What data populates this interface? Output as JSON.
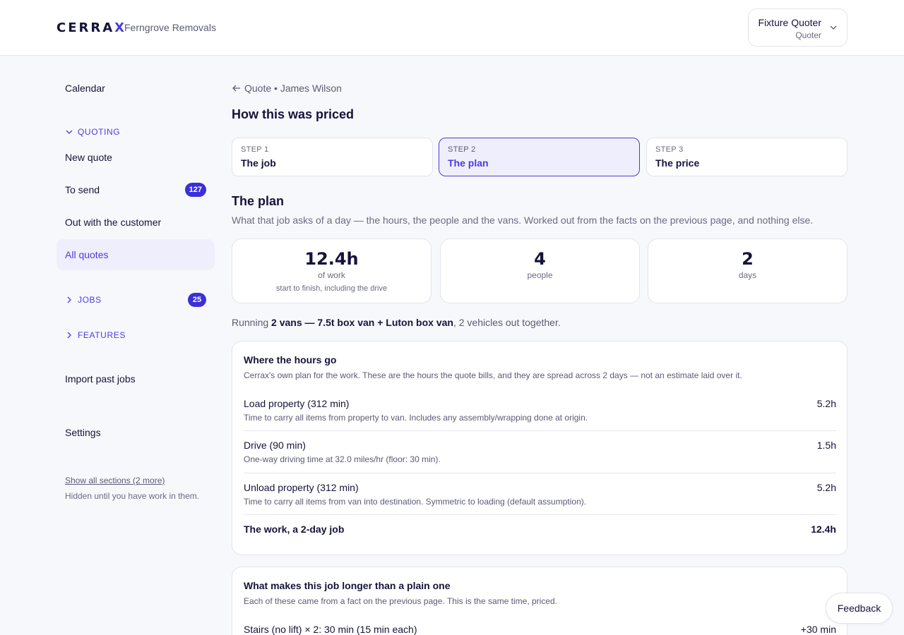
{
  "header": {
    "logo_main": "CERRA",
    "logo_accent": "X",
    "company": "Ferngrove Removals",
    "user_name": "Fixture Quoter",
    "user_role": "Quoter"
  },
  "sidebar": {
    "calendar": "Calendar",
    "quoting_section": "QUOTING",
    "new_quote": "New quote",
    "to_send": "To send",
    "to_send_count": "127",
    "out_with_customer": "Out with the customer",
    "all_quotes": "All quotes",
    "jobs_section": "JOBS",
    "jobs_count": "25",
    "features_section": "FEATURES",
    "import_past_jobs": "Import past jobs",
    "settings": "Settings",
    "show_all": "Show all sections (2 more)",
    "hidden_note": "Hidden until you have work in them."
  },
  "main": {
    "breadcrumb": "Quote • James Wilson",
    "title": "How this was priced",
    "steps": [
      {
        "num": "STEP 1",
        "name": "The job"
      },
      {
        "num": "STEP 2",
        "name": "The plan"
      },
      {
        "num": "STEP 3",
        "name": "The price"
      }
    ],
    "section_title": "The plan",
    "section_sub": "What that job asks of a day — the hours, the people and the vans. Worked out from the facts on the previous page, and nothing else.",
    "stats": [
      {
        "value": "12.4h",
        "label": "of work",
        "note": "start to finish, including the drive"
      },
      {
        "value": "4",
        "label": "people"
      },
      {
        "value": "2",
        "label": "days"
      }
    ],
    "running_prefix": "Running",
    "running_bold": "2 vans — 7.5t box van + Luton box van",
    "running_suffix": ", 2 vehicles out together."
  },
  "hours_card": {
    "title": "Where the hours go",
    "subtitle": "Cerrax's own plan for the work. These are the hours the quote bills, and they are spread across 2 days — not an estimate laid over it.",
    "rows": [
      {
        "name": "Load property (312 min)",
        "desc": "Time to carry all items from property to van. Includes any assembly/wrapping done at origin.",
        "value": "5.2h"
      },
      {
        "name": "Drive (90 min)",
        "desc": "One-way driving time at 32.0 miles/hr (floor: 30 min).",
        "value": "1.5h"
      },
      {
        "name": "Unload property (312 min)",
        "desc": "Time to carry all items from van into destination. Symmetric to loading (default assumption).",
        "value": "5.2h"
      }
    ],
    "total_label": "The work, a 2-day job",
    "total_value": "12.4h"
  },
  "longer_card": {
    "title": "What makes this job longer than a plain one",
    "subtitle": "Each of these came from a fact on the previous page. This is the same time, priced.",
    "rows": [
      {
        "name": "Stairs (no lift) × 2: 30 min (15 min each)",
        "value": "+30 min"
      }
    ]
  },
  "feedback": "Feedback",
  "colors": {
    "accent": "#4b3be0",
    "badge": "#3b2fd9",
    "background": "#f7f8fc",
    "text": "#15133a"
  }
}
